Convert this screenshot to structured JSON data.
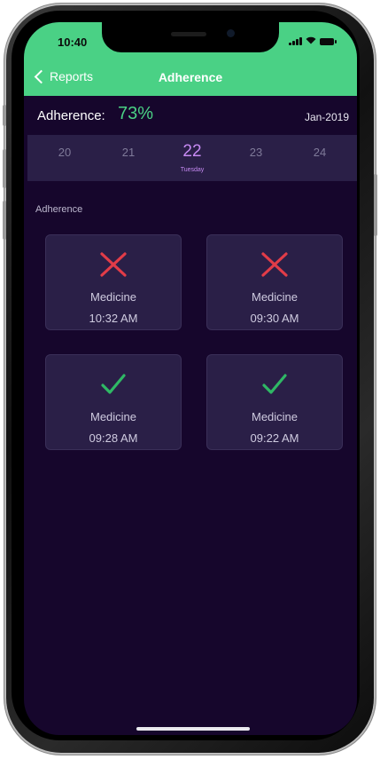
{
  "status_bar": {
    "time": "10:40"
  },
  "nav": {
    "back_label": "Reports",
    "title": "Adherence"
  },
  "summary": {
    "label": "Adherence:",
    "value": "73%",
    "month": "Jan-2019"
  },
  "date_strip": {
    "dates": [
      "20",
      "21",
      "22",
      "23",
      "24"
    ],
    "selected_index": 2,
    "selected_day": "Tuesday"
  },
  "section": {
    "title": "Adherence"
  },
  "cards": [
    {
      "name": "Medicine",
      "time": "10:32 AM",
      "status": "missed",
      "icon": "x-icon"
    },
    {
      "name": "Medicine",
      "time": "09:30 AM",
      "status": "missed",
      "icon": "x-icon"
    },
    {
      "name": "Medicine",
      "time": "09:28 AM",
      "status": "taken",
      "icon": "check-icon"
    },
    {
      "name": "Medicine",
      "time": "09:22 AM",
      "status": "taken",
      "icon": "check-icon"
    }
  ],
  "colors": {
    "accent": "#4ad185",
    "missed": "#e23c48",
    "taken": "#2fb865",
    "background": "#16062c",
    "card": "#2a1f47",
    "selected_date": "#c68af2"
  }
}
